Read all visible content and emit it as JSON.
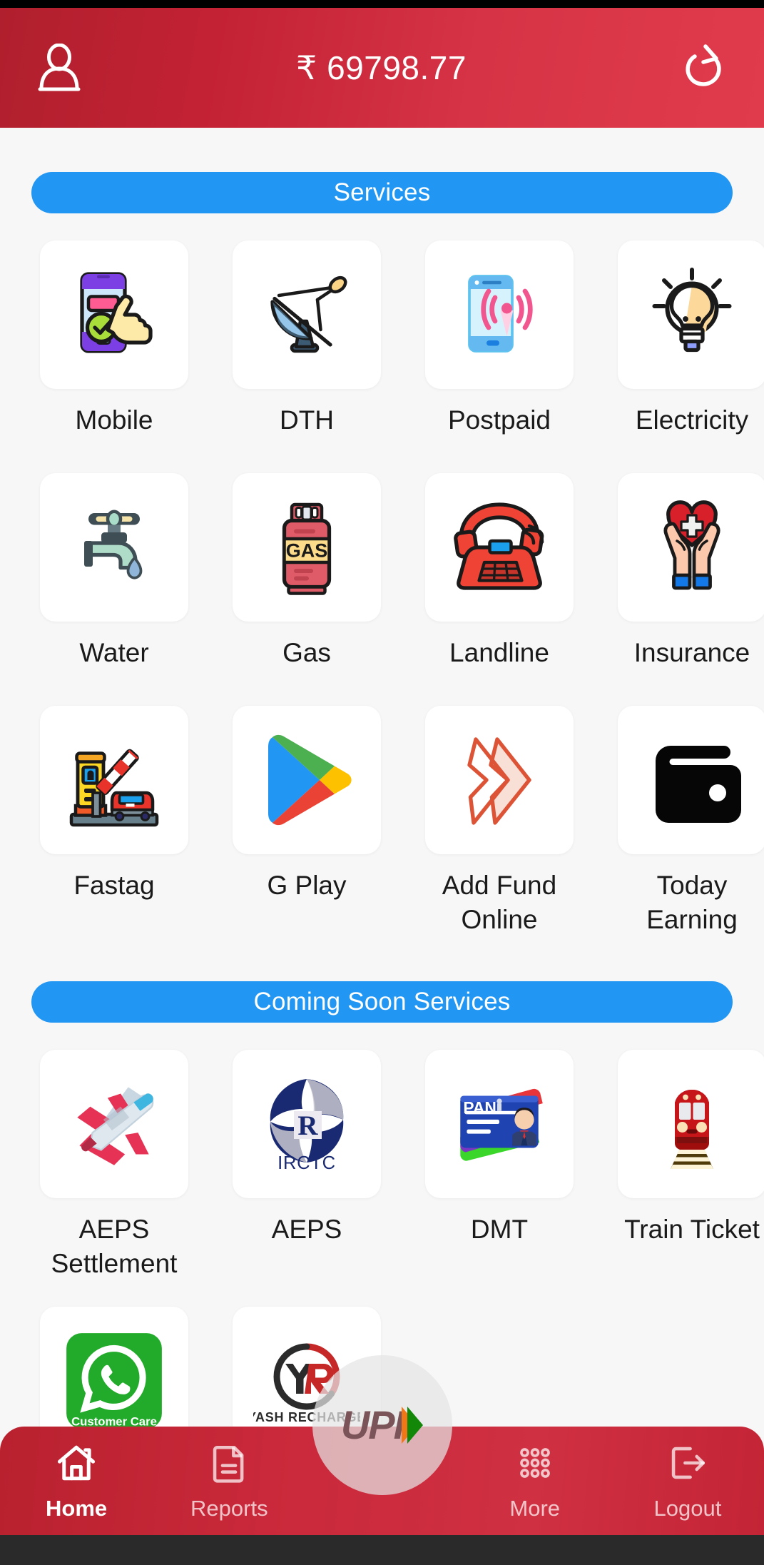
{
  "header": {
    "balance": "₹ 69798.77",
    "profile_icon": "user-icon",
    "refresh_icon": "refresh-icon"
  },
  "sections": [
    {
      "id": "services",
      "title": "Services",
      "items": [
        {
          "label": "Mobile",
          "icon": "mobile-recharge-icon"
        },
        {
          "label": "DTH",
          "icon": "satellite-dish-icon"
        },
        {
          "label": "Postpaid",
          "icon": "postpaid-signal-icon"
        },
        {
          "label": "Electricity",
          "icon": "lightbulb-icon"
        },
        {
          "label": "Water",
          "icon": "water-tap-icon"
        },
        {
          "label": "Gas",
          "icon": "gas-cylinder-icon"
        },
        {
          "label": "Landline",
          "icon": "landline-phone-icon"
        },
        {
          "label": "Insurance",
          "icon": "insurance-heart-hands-icon"
        },
        {
          "label": "Fastag",
          "icon": "fastag-toll-icon"
        },
        {
          "label": "G Play",
          "icon": "google-play-icon"
        },
        {
          "label": "Add Fund Online",
          "icon": "add-fund-arrows-icon"
        },
        {
          "label": "Today Earning",
          "icon": "wallet-icon"
        }
      ]
    },
    {
      "id": "coming-soon",
      "title": "Coming Soon Services",
      "items": [
        {
          "label": "AEPS Settlement",
          "icon": "airplane-icon"
        },
        {
          "label": "AEPS",
          "icon": "irctc-logo-icon",
          "logo_text": "IRCTC"
        },
        {
          "label": "DMT",
          "icon": "pan-card-icon",
          "logo_text": "PAN"
        },
        {
          "label": "Train Ticket",
          "icon": "train-icon"
        },
        {
          "label": "",
          "icon": "whatsapp-icon",
          "logo_text": "Customer Care"
        },
        {
          "label": "",
          "icon": "yash-recharge-logo-icon",
          "logo_text": "YASH RECHARGE"
        }
      ]
    }
  ],
  "bottom_nav": {
    "items": [
      {
        "label": "Home",
        "icon": "home-icon",
        "active": true
      },
      {
        "label": "Reports",
        "icon": "document-icon",
        "active": false
      },
      {
        "label": "More",
        "icon": "grid-dots-icon",
        "active": false
      },
      {
        "label": "Logout",
        "icon": "logout-icon",
        "active": false
      }
    ],
    "fab": {
      "label": "UPI",
      "icon": "upi-icon"
    }
  },
  "colors": {
    "header_red": "#c32234",
    "banner_blue": "#2196f3",
    "nav_red": "#c9293a",
    "page_bg": "#f7f7f7"
  }
}
